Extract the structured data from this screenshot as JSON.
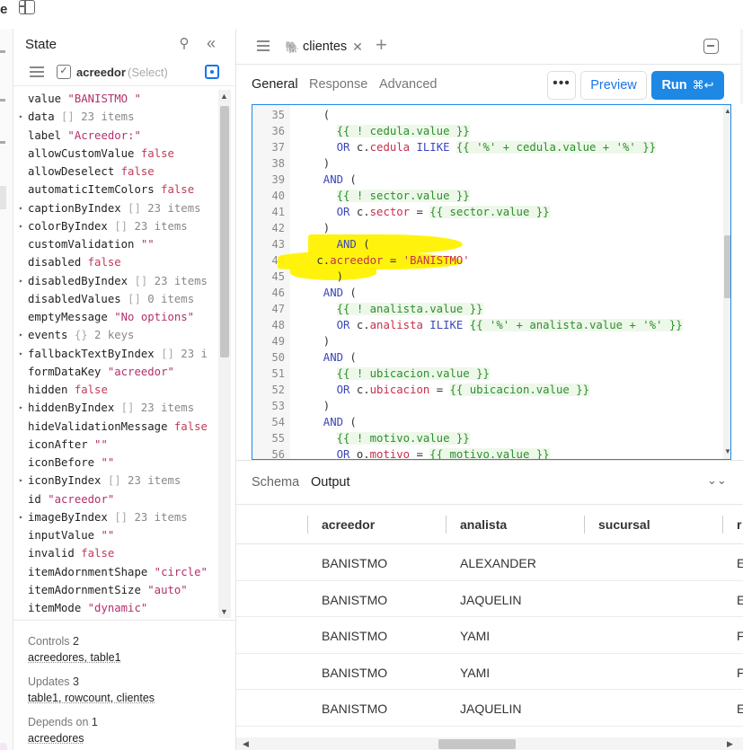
{
  "top": {
    "partial_letter": "e"
  },
  "state_panel": {
    "title": "State",
    "selected": {
      "name": "acreedor",
      "type": "(Select)"
    },
    "properties": [
      {
        "key": "value",
        "value": "\"BANISTMO \"",
        "kind": "str",
        "expandable": false
      },
      {
        "key": "data",
        "value": "[]",
        "meta": "23 items",
        "kind": "arr",
        "expandable": true
      },
      {
        "key": "label",
        "value": "\"Acreedor:\"",
        "kind": "str",
        "expandable": false
      },
      {
        "key": "allowCustomValue",
        "value": "false",
        "kind": "kw",
        "expandable": false
      },
      {
        "key": "allowDeselect",
        "value": "false",
        "kind": "kw",
        "expandable": false
      },
      {
        "key": "automaticItemColors",
        "value": "false",
        "kind": "kw",
        "expandable": false
      },
      {
        "key": "captionByIndex",
        "value": "[]",
        "meta": "23 items",
        "kind": "arr",
        "expandable": true
      },
      {
        "key": "colorByIndex",
        "value": "[]",
        "meta": "23 items",
        "kind": "arr",
        "expandable": true
      },
      {
        "key": "customValidation",
        "value": "\"\"",
        "kind": "str",
        "expandable": false
      },
      {
        "key": "disabled",
        "value": "false",
        "kind": "kw",
        "expandable": false
      },
      {
        "key": "disabledByIndex",
        "value": "[]",
        "meta": "23 items",
        "kind": "arr",
        "expandable": true
      },
      {
        "key": "disabledValues",
        "value": "[]",
        "meta": "0 items",
        "kind": "arr",
        "expandable": false
      },
      {
        "key": "emptyMessage",
        "value": "\"No options\"",
        "kind": "str",
        "expandable": false
      },
      {
        "key": "events",
        "value": "{}",
        "meta": "2 keys",
        "kind": "arr",
        "expandable": true
      },
      {
        "key": "fallbackTextByIndex",
        "value": "[]",
        "meta": "23 i",
        "kind": "arr",
        "expandable": true
      },
      {
        "key": "formDataKey",
        "value": "\"acreedor\"",
        "kind": "str",
        "expandable": false
      },
      {
        "key": "hidden",
        "value": "false",
        "kind": "kw",
        "expandable": false
      },
      {
        "key": "hiddenByIndex",
        "value": "[]",
        "meta": "23 items",
        "kind": "arr",
        "expandable": true
      },
      {
        "key": "hideValidationMessage",
        "value": "false",
        "kind": "kw",
        "expandable": false
      },
      {
        "key": "iconAfter",
        "value": "\"\"",
        "kind": "str",
        "expandable": false
      },
      {
        "key": "iconBefore",
        "value": "\"\"",
        "kind": "str",
        "expandable": false
      },
      {
        "key": "iconByIndex",
        "value": "[]",
        "meta": "23 items",
        "kind": "arr",
        "expandable": true
      },
      {
        "key": "id",
        "value": "\"acreedor\"",
        "kind": "str",
        "expandable": false
      },
      {
        "key": "imageByIndex",
        "value": "[]",
        "meta": "23 items",
        "kind": "arr",
        "expandable": true
      },
      {
        "key": "inputValue",
        "value": "\"\"",
        "kind": "str",
        "expandable": false
      },
      {
        "key": "invalid",
        "value": "false",
        "kind": "kw",
        "expandable": false
      },
      {
        "key": "itemAdornmentShape",
        "value": "\"circle\"",
        "kind": "str",
        "expandable": false
      },
      {
        "key": "itemAdornmentSize",
        "value": "\"auto\"",
        "kind": "str",
        "expandable": false
      },
      {
        "key": "itemMode",
        "value": "\"dynamic\"",
        "kind": "str",
        "expandable": false
      }
    ],
    "dependencies": [
      {
        "label": "Controls",
        "count": "2",
        "items": "acreedores, table1"
      },
      {
        "label": "Updates",
        "count": "3",
        "items": "table1, rowcount, clientes"
      },
      {
        "label": "Depends on",
        "count": "1",
        "items": "acreedores"
      }
    ]
  },
  "query_editor": {
    "tab": {
      "label": "clientes"
    },
    "subtabs": [
      "General",
      "Response",
      "Advanced"
    ],
    "active_subtab": "General",
    "more_label": "•••",
    "preview_label": "Preview",
    "run_label": "Run",
    "run_shortcut": "⌘↩",
    "code_lines": [
      {
        "n": "35",
        "tokens": [
          [
            "",
            "  ("
          ]
        ]
      },
      {
        "n": "36",
        "tokens": [
          [
            "",
            "    "
          ],
          [
            "tpl",
            "{{ ! cedula.value }}"
          ]
        ]
      },
      {
        "n": "37",
        "tokens": [
          [
            "",
            "    "
          ],
          [
            "kw",
            "OR "
          ],
          [
            "",
            "c."
          ],
          [
            "fld",
            "cedula"
          ],
          [
            "kw",
            " ILIKE "
          ],
          [
            "tpl",
            "{{ '%' + cedula.value + '%' }}"
          ]
        ]
      },
      {
        "n": "38",
        "tokens": [
          [
            "",
            "  )"
          ]
        ]
      },
      {
        "n": "39",
        "tokens": [
          [
            "kw",
            "  AND "
          ],
          [
            "",
            "("
          ]
        ]
      },
      {
        "n": "40",
        "tokens": [
          [
            "",
            "    "
          ],
          [
            "tpl",
            "{{ ! sector.value }}"
          ]
        ]
      },
      {
        "n": "41",
        "tokens": [
          [
            "",
            "    "
          ],
          [
            "kw",
            "OR "
          ],
          [
            "",
            "c."
          ],
          [
            "fld",
            "sector"
          ],
          [
            "",
            " = "
          ],
          [
            "tpl",
            "{{ sector.value }}"
          ]
        ]
      },
      {
        "n": "42",
        "tokens": [
          [
            "",
            "  )"
          ]
        ]
      },
      {
        "n": "43",
        "tokens": [
          [
            "kw",
            "    AND "
          ],
          [
            "",
            "("
          ]
        ]
      },
      {
        "n": "44",
        "tokens": [
          [
            "",
            " c."
          ],
          [
            "fld",
            "acreedor"
          ],
          [
            "",
            " = "
          ],
          [
            "str",
            "'BANISTMO'"
          ]
        ]
      },
      {
        "n": "45",
        "tokens": [
          [
            "",
            "    )"
          ]
        ]
      },
      {
        "n": "46",
        "tokens": [
          [
            "kw",
            "  AND "
          ],
          [
            "",
            "("
          ]
        ]
      },
      {
        "n": "47",
        "tokens": [
          [
            "",
            "    "
          ],
          [
            "tpl",
            "{{ ! analista.value }}"
          ]
        ]
      },
      {
        "n": "48",
        "tokens": [
          [
            "",
            "    "
          ],
          [
            "kw",
            "OR "
          ],
          [
            "",
            "c."
          ],
          [
            "fld",
            "analista"
          ],
          [
            "kw",
            " ILIKE "
          ],
          [
            "tpl",
            "{{ '%' + analista.value + '%' }}"
          ]
        ]
      },
      {
        "n": "49",
        "tokens": [
          [
            "",
            "  )"
          ]
        ]
      },
      {
        "n": "50",
        "tokens": [
          [
            "kw",
            "  AND "
          ],
          [
            "",
            "("
          ]
        ]
      },
      {
        "n": "51",
        "tokens": [
          [
            "",
            "    "
          ],
          [
            "tpl",
            "{{ ! ubicacion.value }}"
          ]
        ]
      },
      {
        "n": "52",
        "tokens": [
          [
            "",
            "    "
          ],
          [
            "kw",
            "OR "
          ],
          [
            "",
            "c."
          ],
          [
            "fld",
            "ubicacion"
          ],
          [
            "",
            " = "
          ],
          [
            "tpl",
            "{{ ubicacion.value }}"
          ]
        ]
      },
      {
        "n": "53",
        "tokens": [
          [
            "",
            "  )"
          ]
        ]
      },
      {
        "n": "54",
        "tokens": [
          [
            "kw",
            "  AND "
          ],
          [
            "",
            "("
          ]
        ]
      },
      {
        "n": "55",
        "tokens": [
          [
            "",
            "    "
          ],
          [
            "tpl",
            "{{ ! motivo.value }}"
          ]
        ]
      },
      {
        "n": "56",
        "tokens": [
          [
            "",
            "    "
          ],
          [
            "kw",
            "OR "
          ],
          [
            "",
            "o."
          ],
          [
            "fld",
            "motivo"
          ],
          [
            "",
            " = "
          ],
          [
            "tpl",
            "{{ motivo.value }}"
          ]
        ]
      }
    ],
    "results": {
      "tabs": [
        "Schema",
        "Output"
      ],
      "active_tab": "Output",
      "columns": [
        "acreedor",
        "analista",
        "sucursal",
        "r"
      ],
      "rows": [
        [
          "BANISTMO",
          "ALEXANDER",
          "",
          "E"
        ],
        [
          "BANISTMO",
          "JAQUELIN",
          "",
          "E"
        ],
        [
          "BANISTMO",
          "YAMI",
          "",
          "F"
        ],
        [
          "BANISTMO",
          "YAMI",
          "",
          "F"
        ],
        [
          "BANISTMO",
          "JAQUELIN",
          "",
          "E"
        ]
      ]
    }
  },
  "colors": {
    "accent": "#1e88e5",
    "highlight": "#fff200",
    "keyword": "#3b47b8",
    "template": "#2d8f2d",
    "field": "#c5304a"
  }
}
